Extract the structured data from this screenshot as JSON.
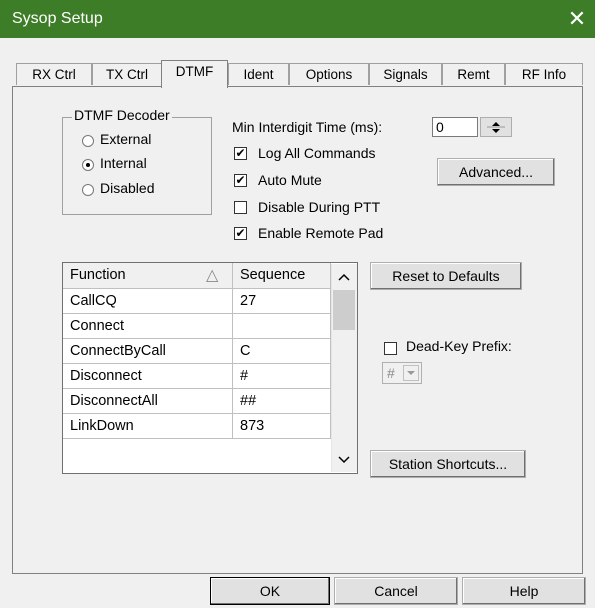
{
  "window": {
    "title": "Sysop Setup",
    "close_symbol": "✕"
  },
  "tabs": [
    {
      "label": "RX Ctrl"
    },
    {
      "label": "TX Ctrl"
    },
    {
      "label": "DTMF",
      "active": true
    },
    {
      "label": "Ident"
    },
    {
      "label": "Options"
    },
    {
      "label": "Signals"
    },
    {
      "label": "Remt"
    },
    {
      "label": "RF Info"
    }
  ],
  "decoder": {
    "legend": "DTMF Decoder",
    "options": [
      {
        "label": "External",
        "selected": false
      },
      {
        "label": "Internal",
        "selected": true
      },
      {
        "label": "Disabled",
        "selected": false
      }
    ]
  },
  "interdigit": {
    "label": "Min Interdigit Time (ms):",
    "value": "0"
  },
  "checkboxes": [
    {
      "label": "Log All Commands",
      "checked": true
    },
    {
      "label": "Auto Mute",
      "checked": true
    },
    {
      "label": "Disable During PTT",
      "checked": false
    },
    {
      "label": "Enable Remote Pad",
      "checked": true
    }
  ],
  "advanced_label": "Advanced...",
  "reset_label": "Reset to Defaults",
  "dead_key": {
    "label": "Dead-Key Prefix:",
    "checked": false,
    "value": "#"
  },
  "station_shortcuts_label": "Station Shortcuts...",
  "table": {
    "headers": [
      "Function",
      "Sequence"
    ],
    "sort_glyph": "△",
    "rows": [
      [
        "CallCQ",
        "27"
      ],
      [
        "Connect",
        ""
      ],
      [
        "ConnectByCall",
        "C"
      ],
      [
        "Disconnect",
        "#"
      ],
      [
        "DisconnectAll",
        "##"
      ],
      [
        "LinkDown",
        "873"
      ]
    ]
  },
  "footer": {
    "ok": "OK",
    "cancel": "Cancel",
    "help": "Help"
  },
  "colors": {
    "titlebar": "#3e7d28",
    "background": "#f0f0f0"
  }
}
